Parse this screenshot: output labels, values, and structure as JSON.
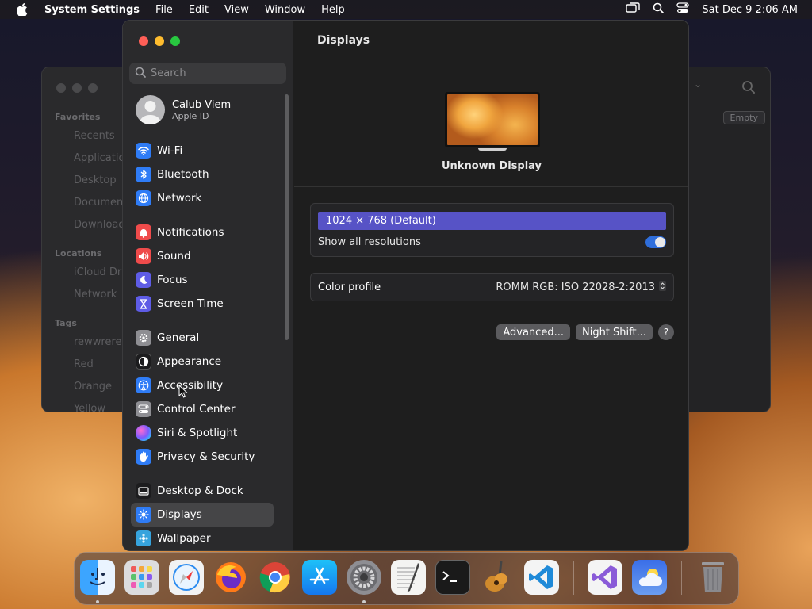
{
  "menubar": {
    "app_name": "System Settings",
    "menus": [
      "File",
      "Edit",
      "View",
      "Window",
      "Help"
    ],
    "clock": "Sat Dec 9  2:06 AM"
  },
  "finder": {
    "favorites_header": "Favorites",
    "favorites": [
      "Recents",
      "Applications",
      "Desktop",
      "Documents",
      "Downloads"
    ],
    "locations_header": "Locations",
    "locations": [
      "iCloud Drive",
      "Network"
    ],
    "tags_header": "Tags",
    "tags": [
      "rewwrerer",
      "Red",
      "Orange",
      "Yellow"
    ],
    "empty_label": "Empty"
  },
  "sidebar": {
    "search_placeholder": "Search",
    "profile": {
      "name": "Calub Viem",
      "subtitle": "Apple ID"
    },
    "items": [
      {
        "label": "Wi-Fi",
        "icon": "wifi-icon",
        "color": "#2f7cf6"
      },
      {
        "label": "Bluetooth",
        "icon": "bluetooth-icon",
        "color": "#2f7cf6"
      },
      {
        "label": "Network",
        "icon": "globe-icon",
        "color": "#2f7cf6"
      },
      {
        "label": "Notifications",
        "icon": "bell-icon",
        "color": "#ef4b4b"
      },
      {
        "label": "Sound",
        "icon": "speaker-icon",
        "color": "#ef4b4b"
      },
      {
        "label": "Focus",
        "icon": "moon-icon",
        "color": "#5e5ce6"
      },
      {
        "label": "Screen Time",
        "icon": "hourglass-icon",
        "color": "#5e5ce6"
      },
      {
        "label": "General",
        "icon": "gear-icon",
        "color": "#8e8e93"
      },
      {
        "label": "Appearance",
        "icon": "appearance-icon",
        "color": "#1c1c1e"
      },
      {
        "label": "Accessibility",
        "icon": "accessibility-icon",
        "color": "#2f7cf6"
      },
      {
        "label": "Control Center",
        "icon": "control-center-icon",
        "color": "#8e8e93"
      },
      {
        "label": "Siri & Spotlight",
        "icon": "siri-icon",
        "color": "#b45adf"
      },
      {
        "label": "Privacy & Security",
        "icon": "hand-icon",
        "color": "#2f7cf6"
      },
      {
        "label": "Desktop & Dock",
        "icon": "dock-icon",
        "color": "#1c1c1e"
      },
      {
        "label": "Displays",
        "icon": "sun-icon",
        "color": "#2f7cf6"
      },
      {
        "label": "Wallpaper",
        "icon": "wallpaper-icon",
        "color": "#36a3dd"
      }
    ],
    "selected": "Displays"
  },
  "main": {
    "title": "Displays",
    "display_name": "Unknown Display",
    "resolution": "1024 × 768 (Default)",
    "show_all_label": "Show all resolutions",
    "show_all_on": true,
    "color_profile_label": "Color profile",
    "color_profile_value": "ROMM RGB: ISO 22028-2:2013",
    "advanced_label": "Advanced...",
    "night_shift_label": "Night Shift...",
    "help_label": "?"
  },
  "dock": {
    "apps": [
      "Finder",
      "Launchpad",
      "Safari",
      "Firefox",
      "Chrome",
      "App Store",
      "System Settings",
      "TextEdit",
      "Terminal",
      "GarageBand",
      "Visual Studio Code",
      "Visual Studio",
      "Weather",
      "Trash"
    ]
  }
}
